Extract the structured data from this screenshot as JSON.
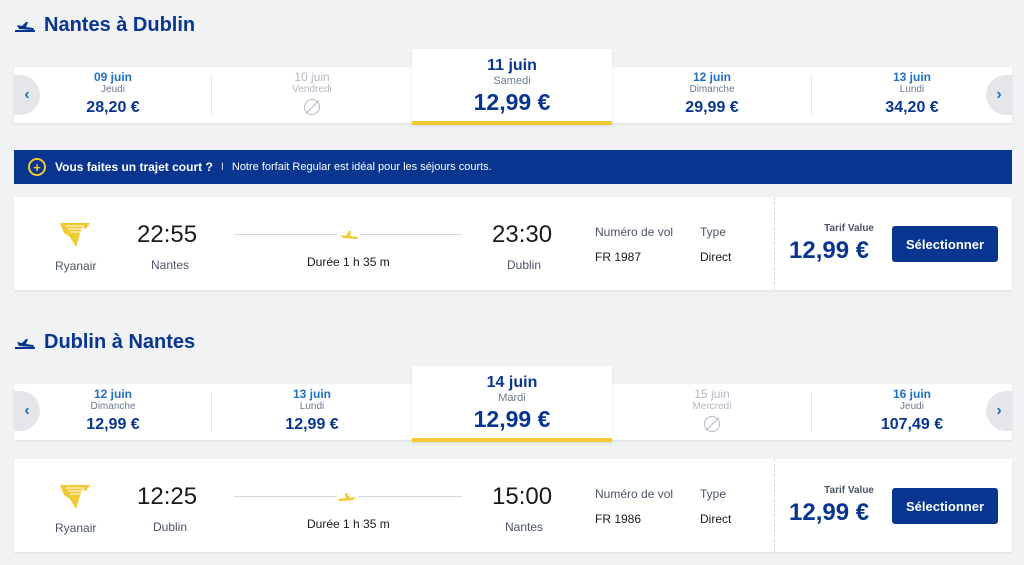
{
  "outbound": {
    "title": "Nantes à Dublin",
    "dates": [
      {
        "date": "09 juin",
        "day": "Jeudi",
        "price": "28,20 €",
        "available": true
      },
      {
        "date": "10 juin",
        "day": "Vendredi",
        "price": "",
        "available": false
      },
      {
        "date": "11 juin",
        "day": "Samedi",
        "price": "12,99 €",
        "available": true,
        "selected": true
      },
      {
        "date": "12 juin",
        "day": "Dimanche",
        "price": "29,99 €",
        "available": true
      },
      {
        "date": "13 juin",
        "day": "Lundi",
        "price": "34,20 €",
        "available": true
      }
    ],
    "flight": {
      "airline": "Ryanair",
      "depart_time": "22:55",
      "depart_city": "Nantes",
      "duration": "Durée 1 h 35 m",
      "arrive_time": "23:30",
      "arrive_city": "Dublin",
      "flight_number_label": "Numéro de vol",
      "flight_number": "FR 1987",
      "type_label": "Type",
      "type": "Direct",
      "tarif_label": "Tarif Value",
      "price": "12,99 €",
      "select_label": "Sélectionner"
    }
  },
  "banner": {
    "icon": "plus-circle-icon",
    "bold_text": "Vous faites un trajet court ?",
    "separator": "I",
    "text": "Notre forfait Regular est idéal pour les séjours courts."
  },
  "return": {
    "title": "Dublin à Nantes",
    "dates": [
      {
        "date": "12 juin",
        "day": "Dimanche",
        "price": "12,99 €",
        "available": true
      },
      {
        "date": "13 juin",
        "day": "Lundi",
        "price": "12,99 €",
        "available": true
      },
      {
        "date": "14 juin",
        "day": "Mardi",
        "price": "12,99 €",
        "available": true,
        "selected": true
      },
      {
        "date": "15 juin",
        "day": "Mercredi",
        "price": "",
        "available": false
      },
      {
        "date": "16 juin",
        "day": "Jeudi",
        "price": "107,49 €",
        "available": true
      }
    ],
    "flight": {
      "airline": "Ryanair",
      "depart_time": "12:25",
      "depart_city": "Dublin",
      "duration": "Durée 1 h 35 m",
      "arrive_time": "15:00",
      "arrive_city": "Nantes",
      "flight_number_label": "Numéro de vol",
      "flight_number": "FR 1986",
      "type_label": "Type",
      "type": "Direct",
      "tarif_label": "Tarif Value",
      "price": "12,99 €",
      "select_label": "Sélectionner"
    }
  },
  "colors": {
    "brand_blue": "#073590",
    "accent_yellow": "#f1c931",
    "link_blue": "#1f6fc5"
  }
}
